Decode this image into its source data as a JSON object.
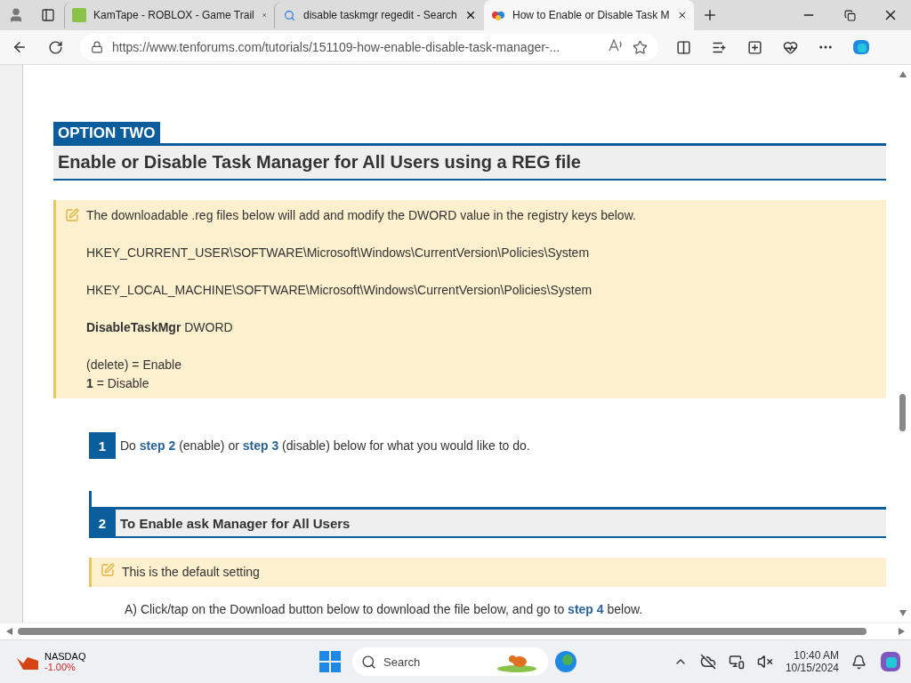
{
  "tabs": [
    {
      "title": "KamTape - ROBLOX - Game Trail",
      "kind": "site",
      "selected": false
    },
    {
      "title": "disable taskmgr regedit - Search",
      "kind": "search",
      "selected": false
    },
    {
      "title": "How to Enable or Disable Task M",
      "kind": "forum",
      "selected": true
    }
  ],
  "address_bar": {
    "url": "https://www.tenforums.com/tutorials/151109-how-enable-disable-task-manager-..."
  },
  "article": {
    "option_label": "OPTION TWO",
    "heading": "Enable or Disable Task Manager for All Users using a REG file",
    "note": [
      "The downloadable .reg files below will add and modify the DWORD value in the registry keys below.",
      "HKEY_CURRENT_USER\\SOFTWARE\\Microsoft\\Windows\\CurrentVersion\\Policies\\System",
      "HKEY_LOCAL_MACHINE\\SOFTWARE\\Microsoft\\Windows\\CurrentVersion\\Policies\\System",
      "**DisableTaskMgr** DWORD",
      [
        "(delete) = Enable",
        "**1** = Disable"
      ]
    ],
    "steps": [
      {
        "number": "1",
        "kind": "plain",
        "text": "Do **step 2** (enable) or **step 3** (disable) below for what you would like to do."
      },
      {
        "number": "2",
        "kind": "header",
        "text": "To Enable ask Manager for All Users",
        "note": "This is the default setting",
        "body": "A) Click/tap on the Download button below to download the file below, and go to **step 4** below."
      }
    ]
  },
  "taskbar": {
    "widget": {
      "name": "NASDAQ",
      "change": "-1.00%"
    },
    "search_placeholder": "Search",
    "time": "10:40 AM",
    "date": "10/15/2024"
  }
}
